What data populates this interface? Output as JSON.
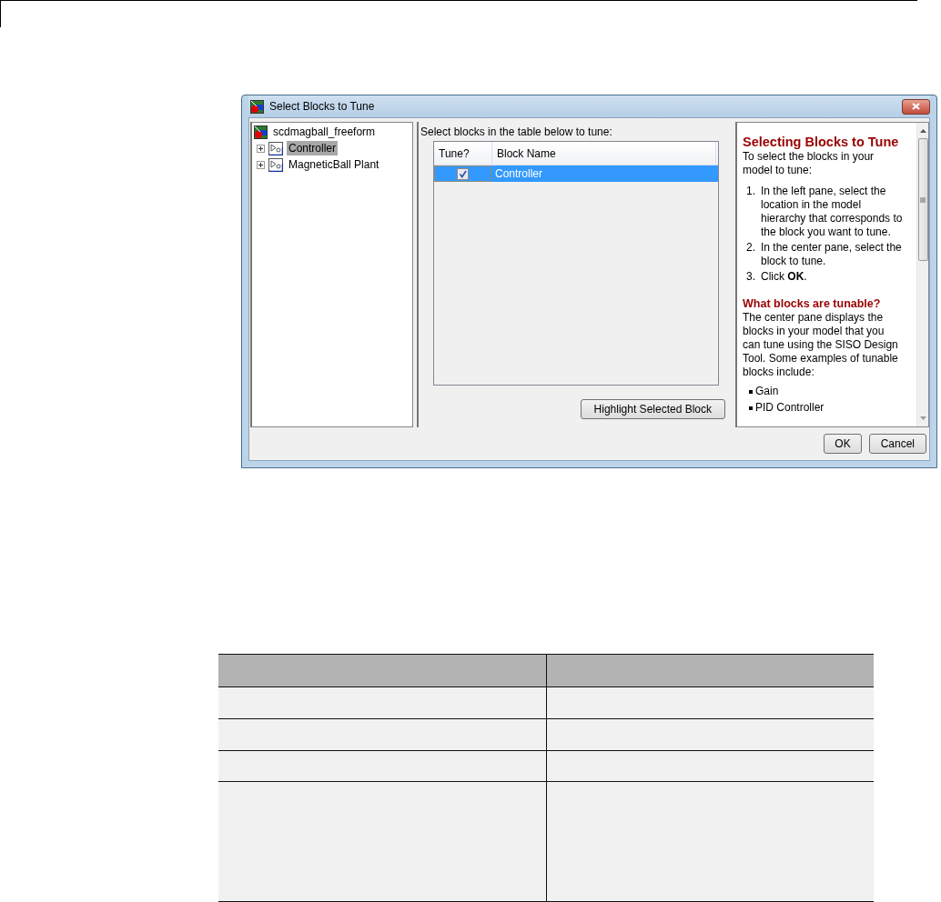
{
  "window": {
    "title": "Select Blocks to Tune"
  },
  "tree": {
    "label": "scdmagball_freeform",
    "children": [
      {
        "label": "Controller",
        "expanded": false,
        "selected": true
      },
      {
        "label": "MagneticBall Plant",
        "expanded": false,
        "selected": false
      }
    ]
  },
  "center": {
    "instruction": "Select blocks in the table below to tune:",
    "table": {
      "columns": [
        "Tune?",
        "Block Name"
      ],
      "rows": [
        {
          "tune": true,
          "name": "Controller",
          "selected": true
        }
      ]
    },
    "button": "Highlight Selected Block"
  },
  "help": {
    "title": "Selecting Blocks to Tune",
    "intro": "To select the blocks in your model to tune:",
    "steps": [
      {
        "number": "1.",
        "text": "In the left pane, select the location in the model hierarchy that corresponds to the block you want to tune."
      },
      {
        "number": "2.",
        "text": "In the center pane, select the block to tune."
      },
      {
        "number": "3.",
        "text": "Click **OK**."
      }
    ],
    "subtitle": "What blocks are tunable?",
    "paragraph": "The center pane displays the blocks in your model that you can tune using the SISO Design Tool. Some examples of tunable blocks include:",
    "bullets": [
      "Gain",
      "PID Controller"
    ]
  },
  "buttons": [
    "OK",
    "Cancel"
  ]
}
